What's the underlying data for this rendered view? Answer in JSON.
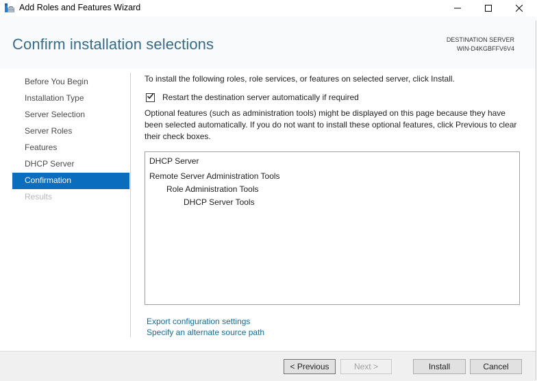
{
  "window": {
    "title": "Add Roles and Features Wizard",
    "icons": {
      "app": "server-manager-icon",
      "minimize": "minimize-icon",
      "maximize": "maximize-icon",
      "close": "close-icon"
    }
  },
  "header": {
    "page_title": "Confirm installation selections",
    "destination_label": "DESTINATION SERVER",
    "destination_server": "WIN-D4KGBFFV6V4"
  },
  "nav": {
    "items": [
      {
        "label": "Before You Begin",
        "state": "normal"
      },
      {
        "label": "Installation Type",
        "state": "normal"
      },
      {
        "label": "Server Selection",
        "state": "normal"
      },
      {
        "label": "Server Roles",
        "state": "normal"
      },
      {
        "label": "Features",
        "state": "normal"
      },
      {
        "label": "DHCP Server",
        "state": "normal"
      },
      {
        "label": "Confirmation",
        "state": "active"
      },
      {
        "label": "Results",
        "state": "disabled"
      }
    ]
  },
  "content": {
    "intro": "To install the following roles, role services, or features on selected server, click Install.",
    "restart_checkbox": {
      "label": "Restart the destination server automatically if required",
      "checked": true
    },
    "optional_note": "Optional features (such as administration tools) might be displayed on this page because they have been selected automatically. If you do not want to install these optional features, click Previous to clear their check boxes.",
    "selections": [
      {
        "label": "DHCP Server",
        "level": 0
      },
      {
        "label": "Remote Server Administration Tools",
        "level": 0
      },
      {
        "label": "Role Administration Tools",
        "level": 1
      },
      {
        "label": "DHCP Server Tools",
        "level": 2
      }
    ],
    "links": {
      "export": "Export configuration settings",
      "alternate_source": "Specify an alternate source path"
    }
  },
  "footer": {
    "previous": "< Previous",
    "next": "Next >",
    "install": "Install",
    "cancel": "Cancel",
    "next_enabled": false
  },
  "colors": {
    "title_accent": "#356b8a",
    "nav_active_bg": "#0b6dbd",
    "link": "#0e6d9b"
  }
}
